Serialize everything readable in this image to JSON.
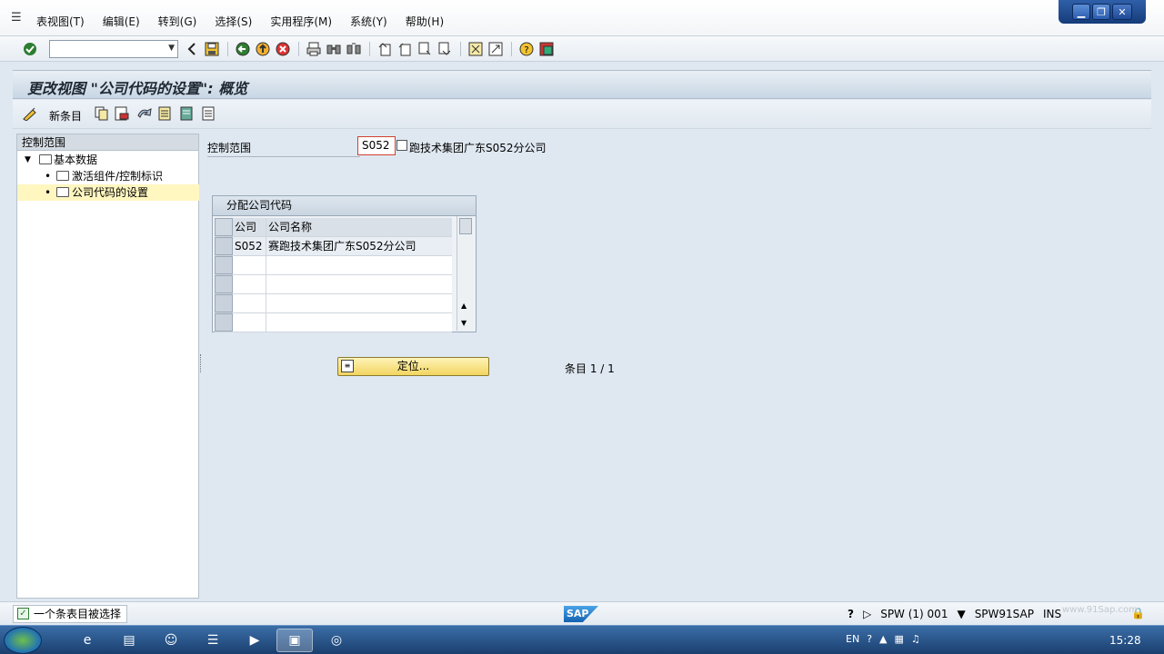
{
  "menu": {
    "items": [
      "表视图(T)",
      "编辑(E)",
      "转到(G)",
      "选择(S)",
      "实用程序(M)",
      "系统(Y)",
      "帮助(H)"
    ]
  },
  "window_controls": [
    "minimize",
    "restore",
    "close"
  ],
  "toolbar": {
    "command_field_value": "",
    "icons": [
      "enter-icon",
      "back-icon",
      "save-icon",
      "back-nav-icon",
      "exit-icon",
      "cancel-icon",
      "print-icon",
      "find-icon",
      "find-next-icon",
      "first-page-icon",
      "prev-page-icon",
      "next-page-icon",
      "last-page-icon",
      "create-session-icon",
      "shortcut-icon",
      "help-icon",
      "layout-menu-icon"
    ]
  },
  "title": "更改视图 \"公司代码的设置\": 概览",
  "app_toolbar": {
    "new_entries_label": "新条目"
  },
  "tree": {
    "header": "控制范围",
    "items": [
      {
        "label": "基本数据",
        "level": 0,
        "expanded": true,
        "selected": false
      },
      {
        "label": "激活组件/控制标识",
        "level": 1,
        "expanded": false,
        "selected": false
      },
      {
        "label": "公司代码的设置",
        "level": 1,
        "expanded": false,
        "selected": true
      }
    ]
  },
  "main": {
    "controlling_area_label": "控制范围",
    "controlling_area_value": "S052",
    "controlling_area_desc": "跑技术集团广东S052分公司",
    "table": {
      "title": "分配公司代码",
      "columns": [
        "公司",
        "公司名称"
      ],
      "rows": [
        {
          "code": "S052",
          "name": "赛跑技术集团广东S052分公司"
        }
      ],
      "empty_rows": 4
    },
    "locate_button_label": "定位...",
    "entries_text": "条目 1 / 1"
  },
  "status": {
    "message": "一个条表目被选择",
    "system": "SPW (1) 001",
    "server": "SPW91SAP",
    "mode": "INS",
    "logo": "SAP"
  },
  "taskbar": {
    "tray_lang": "EN",
    "clock": "15:28",
    "watermark": "www.91Sap.com"
  }
}
